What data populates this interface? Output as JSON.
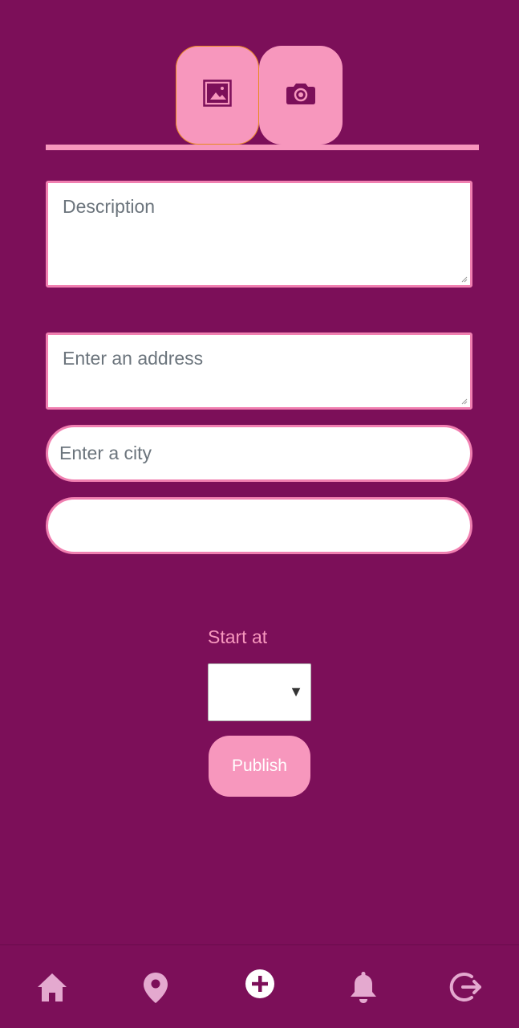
{
  "colors": {
    "background": "#7c0f59",
    "accent_pink": "#f797bd",
    "field_border": "#f07fb0",
    "nav_icon": "#e4a9cf"
  },
  "media_tabs": [
    {
      "icon": "image-icon",
      "active": true
    },
    {
      "icon": "camera-icon",
      "active": false
    }
  ],
  "form": {
    "description_placeholder": "Description",
    "address_placeholder": "Enter an address",
    "city_placeholder": "Enter a city",
    "extra_value": "",
    "start_label": "Start at",
    "select_value": "",
    "publish_label": "Publish"
  },
  "bottom_nav": [
    {
      "icon": "home-icon"
    },
    {
      "icon": "map-pin-icon"
    },
    {
      "icon": "add-circle-icon",
      "active": true
    },
    {
      "icon": "bell-icon"
    },
    {
      "icon": "logout-icon"
    }
  ]
}
